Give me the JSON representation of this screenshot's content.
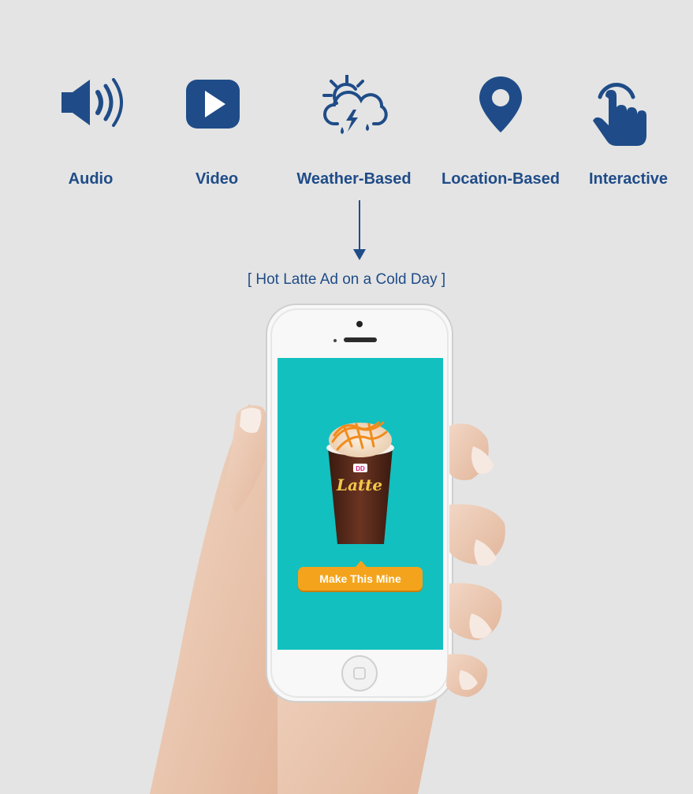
{
  "features": [
    {
      "label": "Audio",
      "icon": "speaker-icon"
    },
    {
      "label": "Video",
      "icon": "play-icon"
    },
    {
      "label": "Weather-Based",
      "icon": "weather-icon"
    },
    {
      "label": "Location-Based",
      "icon": "location-pin-icon"
    },
    {
      "label": "Interactive",
      "icon": "tap-hand-icon"
    }
  ],
  "caption": "[ Hot Latte Ad on a Cold Day ]",
  "ad": {
    "cta_label": "Make This Mine",
    "cup_brand": "DD",
    "cup_text": "Latte"
  },
  "colors": {
    "accent": "#1f4c88",
    "ad_background": "#12c0c0",
    "cta": "#f4a41c",
    "page_background": "#e4e4e4"
  }
}
